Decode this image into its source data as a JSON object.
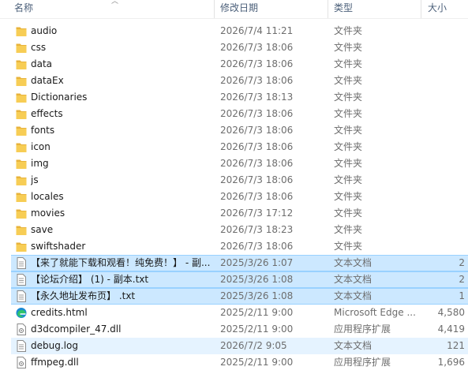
{
  "header": {
    "name": "名称",
    "date": "修改日期",
    "type": "类型",
    "size": "大小"
  },
  "colors": {
    "folder": "#f3c44b",
    "selection": "#cce8ff",
    "hover": "#e5f3ff"
  },
  "rows": [
    {
      "name": "audio",
      "date": "2026/7/4 11:21",
      "type": "文件夹",
      "size": "",
      "icon": "folder-icon",
      "state": ""
    },
    {
      "name": "css",
      "date": "2026/7/3 18:06",
      "type": "文件夹",
      "size": "",
      "icon": "folder-icon",
      "state": ""
    },
    {
      "name": "data",
      "date": "2026/7/3 18:06",
      "type": "文件夹",
      "size": "",
      "icon": "folder-icon",
      "state": ""
    },
    {
      "name": "dataEx",
      "date": "2026/7/3 18:06",
      "type": "文件夹",
      "size": "",
      "icon": "folder-icon",
      "state": ""
    },
    {
      "name": "Dictionaries",
      "date": "2026/7/3 18:13",
      "type": "文件夹",
      "size": "",
      "icon": "folder-icon",
      "state": ""
    },
    {
      "name": "effects",
      "date": "2026/7/3 18:06",
      "type": "文件夹",
      "size": "",
      "icon": "folder-icon",
      "state": ""
    },
    {
      "name": "fonts",
      "date": "2026/7/3 18:06",
      "type": "文件夹",
      "size": "",
      "icon": "folder-icon",
      "state": ""
    },
    {
      "name": "icon",
      "date": "2026/7/3 18:06",
      "type": "文件夹",
      "size": "",
      "icon": "folder-icon",
      "state": ""
    },
    {
      "name": "img",
      "date": "2026/7/3 18:06",
      "type": "文件夹",
      "size": "",
      "icon": "folder-icon",
      "state": ""
    },
    {
      "name": "js",
      "date": "2026/7/3 18:06",
      "type": "文件夹",
      "size": "",
      "icon": "folder-icon",
      "state": ""
    },
    {
      "name": "locales",
      "date": "2026/7/3 18:06",
      "type": "文件夹",
      "size": "",
      "icon": "folder-icon",
      "state": ""
    },
    {
      "name": "movies",
      "date": "2026/7/3 17:12",
      "type": "文件夹",
      "size": "",
      "icon": "folder-icon",
      "state": ""
    },
    {
      "name": "save",
      "date": "2026/7/3 18:23",
      "type": "文件夹",
      "size": "",
      "icon": "folder-icon",
      "state": ""
    },
    {
      "name": "swiftshader",
      "date": "2026/7/3 18:06",
      "type": "文件夹",
      "size": "",
      "icon": "folder-icon",
      "state": ""
    },
    {
      "name": "【来了就能下载和观看！纯免费！】 - 副...",
      "date": "2025/3/26 1:07",
      "type": "文本文档",
      "size": "2",
      "icon": "text-file-icon",
      "state": "sel"
    },
    {
      "name": "【论坛介绍】 (1) - 副本.txt",
      "date": "2025/3/26 1:08",
      "type": "文本文档",
      "size": "2",
      "icon": "text-file-icon",
      "state": "sel"
    },
    {
      "name": "【永久地址发布页】 .txt",
      "date": "2025/3/26 1:08",
      "type": "文本文档",
      "size": "1",
      "icon": "text-file-icon",
      "state": "sel"
    },
    {
      "name": "credits.html",
      "date": "2025/2/11 9:00",
      "type": "Microsoft Edge ...",
      "size": "4,580",
      "icon": "edge-icon",
      "state": ""
    },
    {
      "name": "d3dcompiler_47.dll",
      "date": "2025/2/11 9:00",
      "type": "应用程序扩展",
      "size": "4,419",
      "icon": "dll-file-icon",
      "state": ""
    },
    {
      "name": "debug.log",
      "date": "2026/7/2 9:05",
      "type": "文本文档",
      "size": "121",
      "icon": "text-file-icon",
      "state": "hov"
    },
    {
      "name": "ffmpeg.dll",
      "date": "2025/2/11 9:00",
      "type": "应用程序扩展",
      "size": "1,696",
      "icon": "dll-file-icon",
      "state": ""
    }
  ]
}
